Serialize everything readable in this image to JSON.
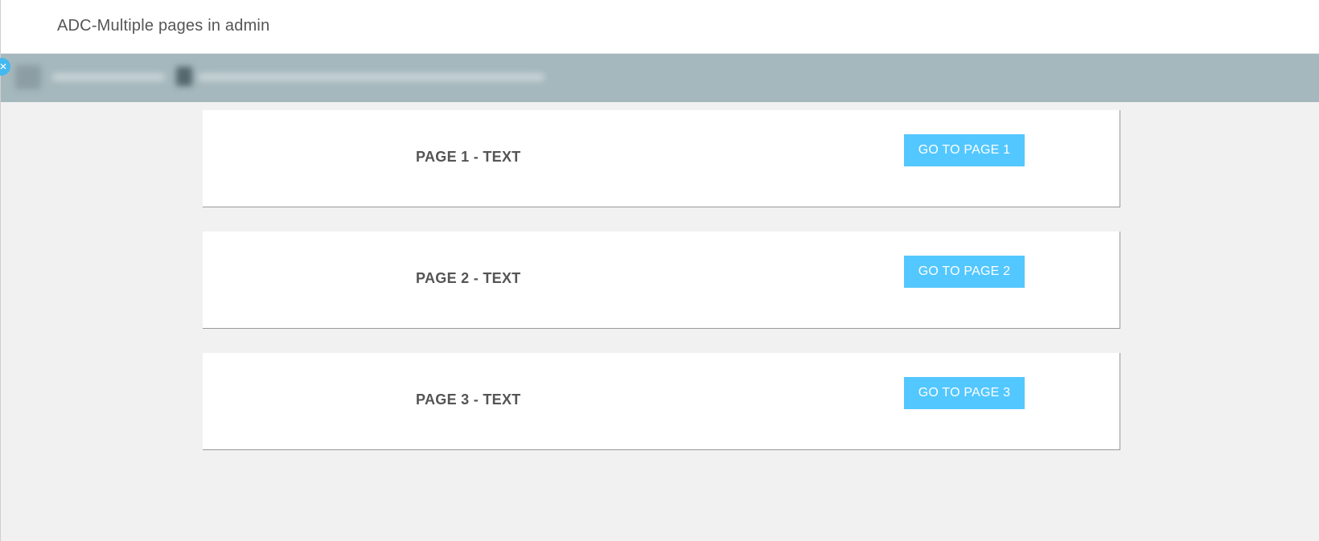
{
  "header": {
    "title": "ADC-Multiple pages in admin"
  },
  "toolbar": {
    "close_icon": "close-icon",
    "accent": "#44b8ef"
  },
  "pages": [
    {
      "text": "PAGE 1 - TEXT",
      "button_label": "GO TO PAGE 1"
    },
    {
      "text": "PAGE 2 - TEXT",
      "button_label": "GO TO PAGE 2"
    },
    {
      "text": "PAGE 3 - TEXT",
      "button_label": "GO TO PAGE 3"
    }
  ],
  "colors": {
    "button": "#53c7ff",
    "toolbar": "#a5b8bd",
    "background": "#f1f1f1"
  }
}
